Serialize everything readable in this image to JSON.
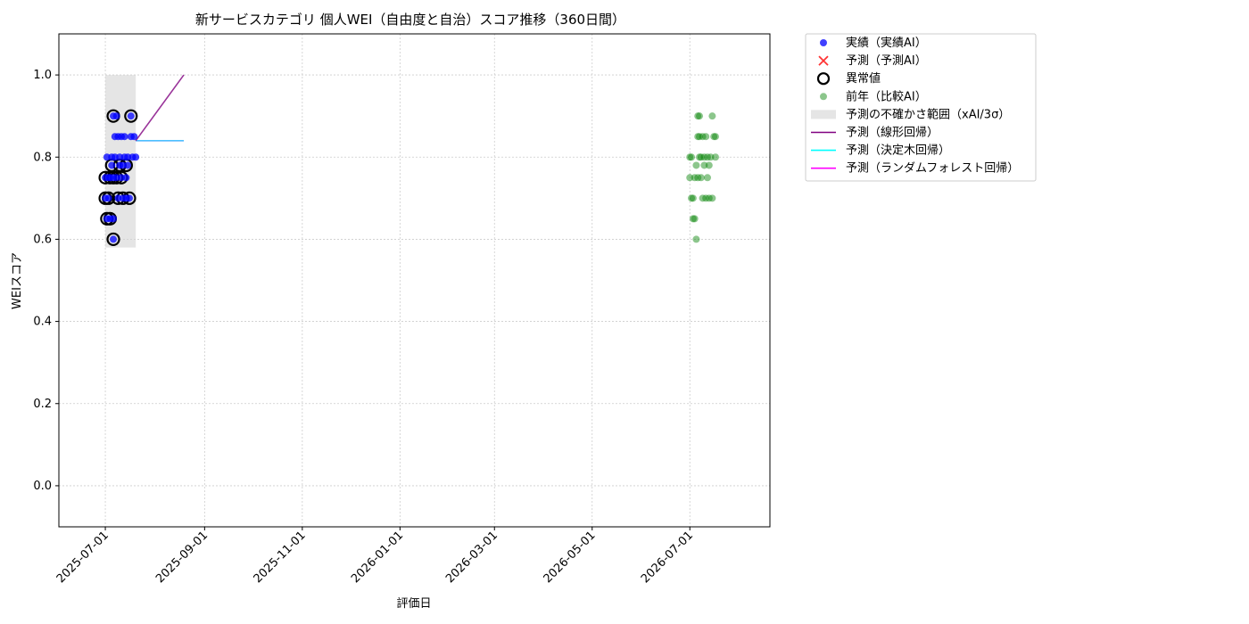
{
  "chart_data": {
    "type": "scatter",
    "title": "新サービスカテゴリ 個人WEI（自由度と自治）スコア推移（360日間）",
    "xlabel": "評価日",
    "ylabel": "WEIスコア",
    "xlim": [
      "2025-06-02",
      "2026-08-20"
    ],
    "ylim": [
      -0.1,
      1.1
    ],
    "y_ticks": [
      0.0,
      0.2,
      0.4,
      0.6,
      0.8,
      1.0
    ],
    "y_tick_labels": [
      "0.0",
      "0.2",
      "0.4",
      "0.6",
      "0.8",
      "1.0"
    ],
    "x_ticks": [
      "2025-07-01",
      "2025-09-01",
      "2025-11-01",
      "2026-01-01",
      "2026-03-01",
      "2026-05-01",
      "2026-07-01"
    ],
    "x_tick_labels": [
      "2025-07-01",
      "2025-09-01",
      "2025-11-01",
      "2026-01-01",
      "2026-03-01",
      "2026-05-01",
      "2026-07-01"
    ],
    "grid": true,
    "legend_position": "outside-top-right",
    "colors": {
      "actual": "#0000ff",
      "predicted": "#ff0000",
      "anomaly_edge": "#000000",
      "previous_year": "#008000",
      "uncertainty": "#d3d3d3",
      "linear": "#800080",
      "tree": "#00ffff",
      "forest": "#ff00ff"
    },
    "legend": [
      {
        "key": "actual",
        "label": "実績（実績AI）"
      },
      {
        "key": "predicted",
        "label": "予測（予測AI）"
      },
      {
        "key": "anomaly",
        "label": "異常値"
      },
      {
        "key": "previous_year",
        "label": "前年（比較AI）"
      },
      {
        "key": "uncertainty",
        "label": "予測の不確かさ範囲（xAI/3σ）"
      },
      {
        "key": "linear",
        "label": "予測（線形回帰）"
      },
      {
        "key": "tree",
        "label": "予測（決定木回帰）"
      },
      {
        "key": "forest",
        "label": "予測（ランダムフォレスト回帰）"
      }
    ],
    "series": [
      {
        "name": "実績（実績AI）",
        "kind": "scatter",
        "points": [
          {
            "x": "2025-07-01",
            "y": 0.75
          },
          {
            "x": "2025-07-01",
            "y": 0.7
          },
          {
            "x": "2025-07-02",
            "y": 0.65
          },
          {
            "x": "2025-07-02",
            "y": 0.8
          },
          {
            "x": "2025-07-03",
            "y": 0.75
          },
          {
            "x": "2025-07-03",
            "y": 0.7
          },
          {
            "x": "2025-07-04",
            "y": 0.65
          },
          {
            "x": "2025-07-04",
            "y": 0.75
          },
          {
            "x": "2025-07-05",
            "y": 0.78
          },
          {
            "x": "2025-07-05",
            "y": 0.8
          },
          {
            "x": "2025-07-06",
            "y": 0.6
          },
          {
            "x": "2025-07-06",
            "y": 0.65
          },
          {
            "x": "2025-07-06",
            "y": 0.75
          },
          {
            "x": "2025-07-06",
            "y": 0.9
          },
          {
            "x": "2025-07-07",
            "y": 0.85
          },
          {
            "x": "2025-07-07",
            "y": 0.8
          },
          {
            "x": "2025-07-08",
            "y": 0.75
          },
          {
            "x": "2025-07-08",
            "y": 0.9
          },
          {
            "x": "2025-07-09",
            "y": 0.85
          },
          {
            "x": "2025-07-09",
            "y": 0.7
          },
          {
            "x": "2025-07-10",
            "y": 0.78
          },
          {
            "x": "2025-07-10",
            "y": 0.8
          },
          {
            "x": "2025-07-11",
            "y": 0.75
          },
          {
            "x": "2025-07-11",
            "y": 0.85
          },
          {
            "x": "2025-07-12",
            "y": 0.7
          },
          {
            "x": "2025-07-12",
            "y": 0.78
          },
          {
            "x": "2025-07-13",
            "y": 0.8
          },
          {
            "x": "2025-07-13",
            "y": 0.85
          },
          {
            "x": "2025-07-14",
            "y": 0.75
          },
          {
            "x": "2025-07-14",
            "y": 0.7
          },
          {
            "x": "2025-07-15",
            "y": 0.78
          },
          {
            "x": "2025-07-15",
            "y": 0.8
          },
          {
            "x": "2025-07-16",
            "y": 0.7
          },
          {
            "x": "2025-07-17",
            "y": 0.85
          },
          {
            "x": "2025-07-17",
            "y": 0.9
          },
          {
            "x": "2025-07-18",
            "y": 0.8
          },
          {
            "x": "2025-07-19",
            "y": 0.85
          },
          {
            "x": "2025-07-20",
            "y": 0.8
          }
        ]
      },
      {
        "name": "異常値",
        "kind": "anomaly",
        "points": [
          {
            "x": "2025-07-01",
            "y": 0.75
          },
          {
            "x": "2025-07-01",
            "y": 0.7
          },
          {
            "x": "2025-07-02",
            "y": 0.65
          },
          {
            "x": "2025-07-03",
            "y": 0.7
          },
          {
            "x": "2025-07-04",
            "y": 0.75
          },
          {
            "x": "2025-07-04",
            "y": 0.65
          },
          {
            "x": "2025-07-05",
            "y": 0.78
          },
          {
            "x": "2025-07-06",
            "y": 0.6
          },
          {
            "x": "2025-07-06",
            "y": 0.75
          },
          {
            "x": "2025-07-06",
            "y": 0.9
          },
          {
            "x": "2025-07-08",
            "y": 0.75
          },
          {
            "x": "2025-07-09",
            "y": 0.7
          },
          {
            "x": "2025-07-10",
            "y": 0.78
          },
          {
            "x": "2025-07-11",
            "y": 0.75
          },
          {
            "x": "2025-07-12",
            "y": 0.7
          },
          {
            "x": "2025-07-14",
            "y": 0.78
          },
          {
            "x": "2025-07-16",
            "y": 0.7
          },
          {
            "x": "2025-07-17",
            "y": 0.9
          }
        ]
      },
      {
        "name": "前年（比較AI）",
        "kind": "scatter",
        "points": [
          {
            "x": "2026-07-01",
            "y": 0.8
          },
          {
            "x": "2026-07-01",
            "y": 0.75
          },
          {
            "x": "2026-07-02",
            "y": 0.7
          },
          {
            "x": "2026-07-02",
            "y": 0.8
          },
          {
            "x": "2026-07-03",
            "y": 0.65
          },
          {
            "x": "2026-07-03",
            "y": 0.7
          },
          {
            "x": "2026-07-04",
            "y": 0.75
          },
          {
            "x": "2026-07-04",
            "y": 0.65
          },
          {
            "x": "2026-07-05",
            "y": 0.78
          },
          {
            "x": "2026-07-05",
            "y": 0.6
          },
          {
            "x": "2026-07-06",
            "y": 0.75
          },
          {
            "x": "2026-07-06",
            "y": 0.85
          },
          {
            "x": "2026-07-06",
            "y": 0.9
          },
          {
            "x": "2026-07-07",
            "y": 0.8
          },
          {
            "x": "2026-07-07",
            "y": 0.9
          },
          {
            "x": "2026-07-07",
            "y": 0.85
          },
          {
            "x": "2026-07-08",
            "y": 0.75
          },
          {
            "x": "2026-07-08",
            "y": 0.8
          },
          {
            "x": "2026-07-09",
            "y": 0.85
          },
          {
            "x": "2026-07-09",
            "y": 0.7
          },
          {
            "x": "2026-07-10",
            "y": 0.78
          },
          {
            "x": "2026-07-10",
            "y": 0.8
          },
          {
            "x": "2026-07-11",
            "y": 0.85
          },
          {
            "x": "2026-07-11",
            "y": 0.7
          },
          {
            "x": "2026-07-12",
            "y": 0.75
          },
          {
            "x": "2026-07-12",
            "y": 0.8
          },
          {
            "x": "2026-07-13",
            "y": 0.78
          },
          {
            "x": "2026-07-13",
            "y": 0.7
          },
          {
            "x": "2026-07-14",
            "y": 0.8
          },
          {
            "x": "2026-07-15",
            "y": 0.9
          },
          {
            "x": "2026-07-15",
            "y": 0.7
          },
          {
            "x": "2026-07-16",
            "y": 0.85
          },
          {
            "x": "2026-07-17",
            "y": 0.85
          },
          {
            "x": "2026-07-17",
            "y": 0.8
          }
        ]
      },
      {
        "name": "予測の不確かさ範囲（xAI/3σ）",
        "kind": "band",
        "x_start": "2025-07-01",
        "x_end": "2025-07-20",
        "y_range": [
          0.58,
          1.0
        ]
      },
      {
        "name": "予測（線形回帰）",
        "kind": "line",
        "points": [
          {
            "x": "2025-07-20",
            "y": 0.84
          },
          {
            "x": "2025-08-19",
            "y": 1.0
          }
        ]
      },
      {
        "name": "予測（決定木回帰）",
        "kind": "line",
        "points": [
          {
            "x": "2025-07-20",
            "y": 0.84
          },
          {
            "x": "2025-08-19",
            "y": 0.84
          }
        ]
      },
      {
        "name": "予測（ランダムフォレスト回帰）",
        "kind": "line",
        "points": [
          {
            "x": "2025-07-20",
            "y": 0.84
          },
          {
            "x": "2025-08-19",
            "y": 0.84
          }
        ]
      }
    ]
  }
}
